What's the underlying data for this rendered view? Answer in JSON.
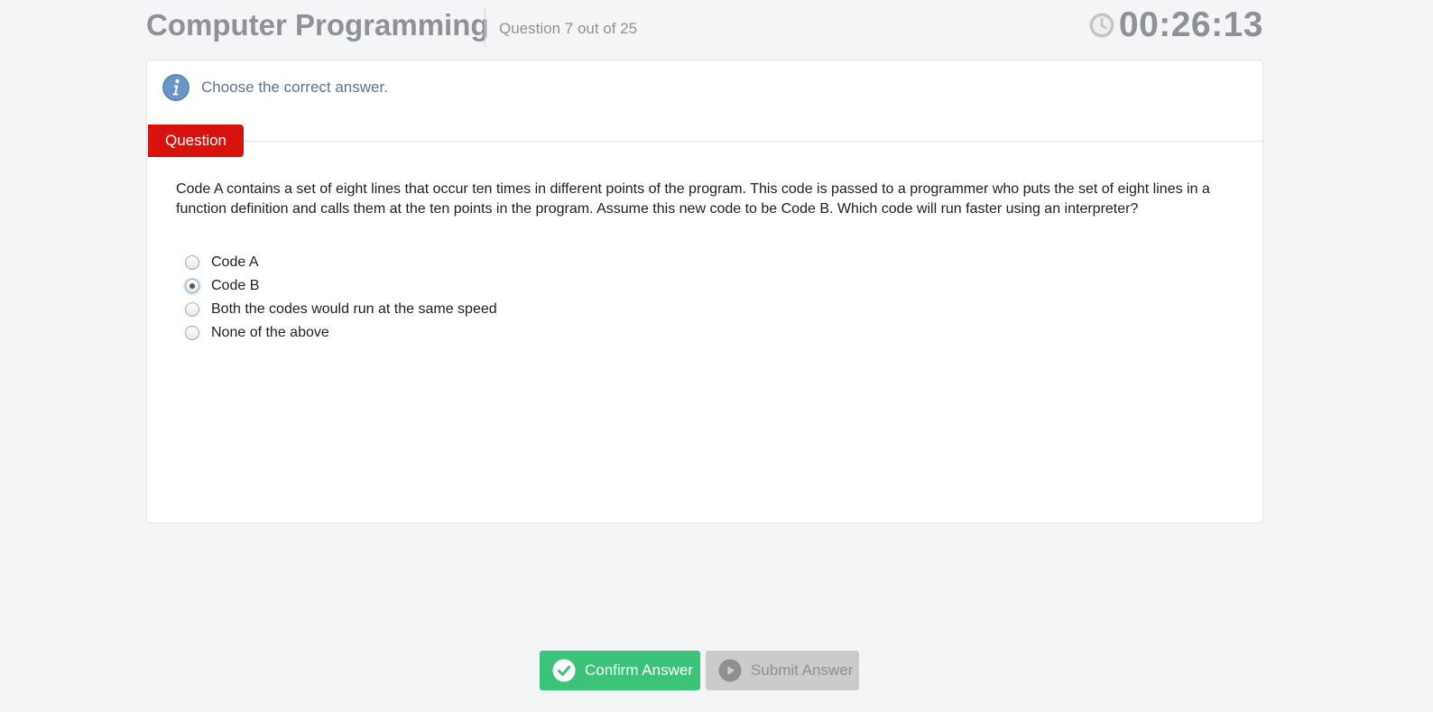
{
  "header": {
    "title": "Computer Programming",
    "question_counter": "Question 7 out of 25",
    "timer": "00:26:13"
  },
  "instruction": {
    "icon": "info-icon",
    "text": "Choose the correct answer."
  },
  "question": {
    "tab_label": "Question",
    "text": "Code A contains a set of eight lines that occur ten times in different points of the program. This code is passed to a programmer who puts the set of eight lines in a function definition and calls them at the ten points in the program. Assume this new code to be Code B. Which code will run faster using an interpreter?",
    "options": [
      {
        "label": "Code A",
        "selected": false
      },
      {
        "label": "Code B",
        "selected": true
      },
      {
        "label": "Both the codes would run at the same speed",
        "selected": false
      },
      {
        "label": "None of the above",
        "selected": false
      }
    ]
  },
  "actions": {
    "confirm_label": "Confirm Answer",
    "submit_label": "Submit Answer"
  },
  "colors": {
    "tab_red": "#d8120d",
    "confirm_green": "#3cc37a",
    "submit_disabled": "#cbcbcb",
    "info_blue": "#5b88bd",
    "header_gray": "#8e9296"
  }
}
